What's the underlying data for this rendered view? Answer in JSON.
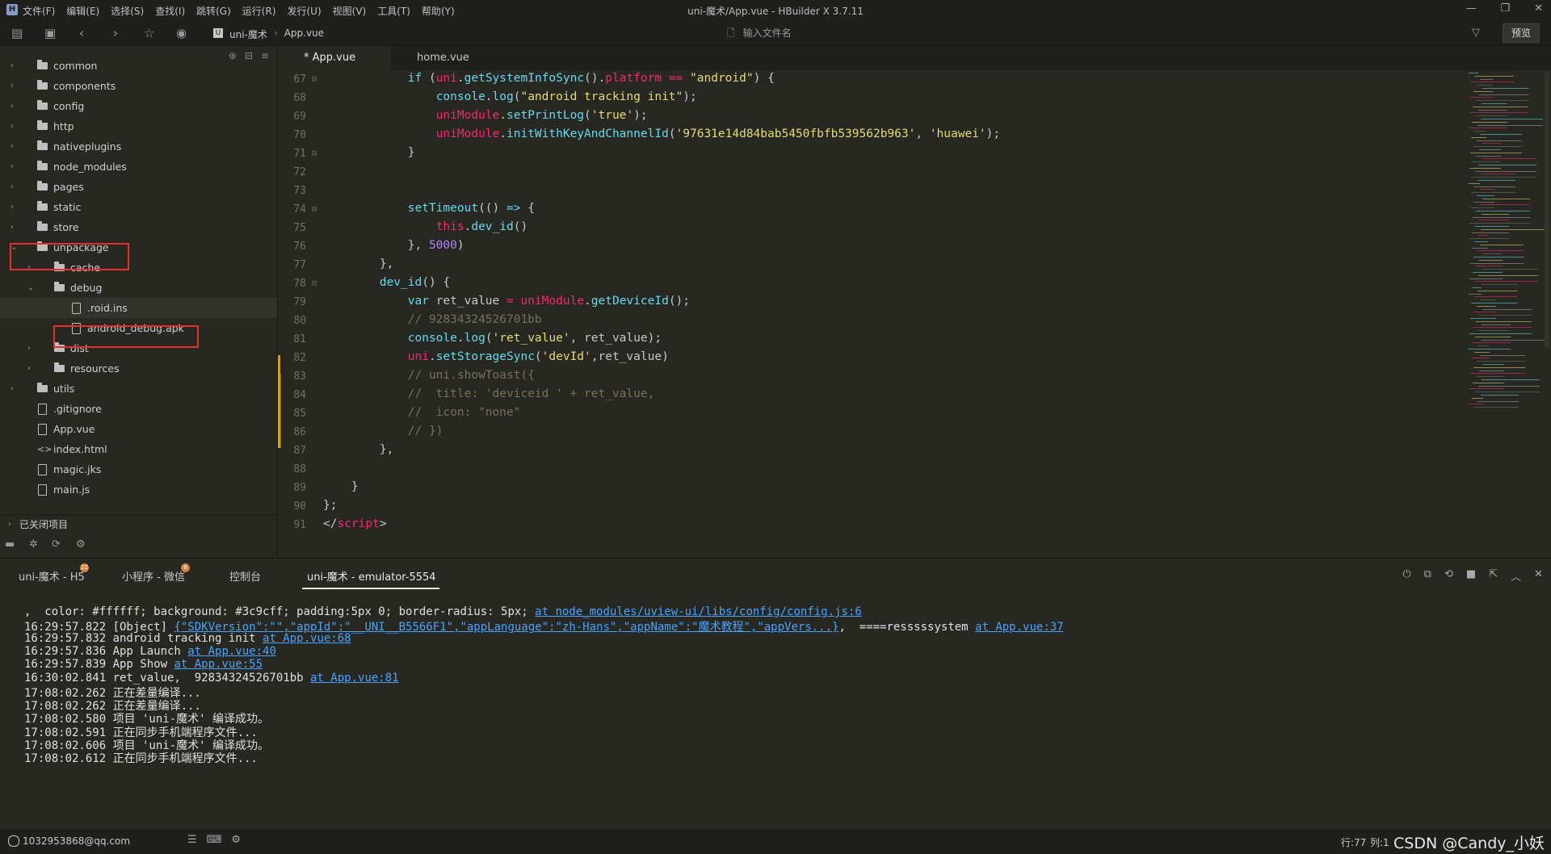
{
  "window": {
    "title": "uni-魔术/App.vue - HBuilder X 3.7.11",
    "menu": [
      "文件(F)",
      "编辑(E)",
      "选择(S)",
      "查找(I)",
      "跳转(G)",
      "运行(R)",
      "发行(U)",
      "视图(V)",
      "工具(T)",
      "帮助(Y)"
    ],
    "controls": [
      "—",
      "❐",
      "✕"
    ]
  },
  "toolbar": {
    "breadcrumb": [
      "uni-魔术",
      "App.vue"
    ],
    "search_placeholder": "输入文件名",
    "preview_label": "预览"
  },
  "sidebar": {
    "items": [
      {
        "label": "common",
        "type": "folder",
        "level": 0,
        "expanded": false
      },
      {
        "label": "components",
        "type": "folder",
        "level": 0,
        "expanded": false
      },
      {
        "label": "config",
        "type": "folder",
        "level": 0,
        "expanded": false
      },
      {
        "label": "http",
        "type": "folder",
        "level": 0,
        "expanded": false
      },
      {
        "label": "nativeplugins",
        "type": "folder",
        "level": 0,
        "expanded": false
      },
      {
        "label": "node_modules",
        "type": "folder",
        "level": 0,
        "expanded": false
      },
      {
        "label": "pages",
        "type": "folder",
        "level": 0,
        "expanded": false
      },
      {
        "label": "static",
        "type": "folder",
        "level": 0,
        "expanded": false
      },
      {
        "label": "store",
        "type": "folder",
        "level": 0,
        "expanded": false
      },
      {
        "label": "unpackage",
        "type": "folder",
        "level": 0,
        "expanded": true,
        "highlighted": true
      },
      {
        "label": "cache",
        "type": "folder",
        "level": 1,
        "expanded": false
      },
      {
        "label": "debug",
        "type": "folder",
        "level": 1,
        "expanded": true
      },
      {
        "label": ".roid.ins",
        "type": "file",
        "level": 2,
        "selected": true
      },
      {
        "label": "android_debug.apk",
        "type": "file",
        "level": 2,
        "highlighted": true
      },
      {
        "label": "dist",
        "type": "folder",
        "level": 1,
        "expanded": false
      },
      {
        "label": "resources",
        "type": "folder",
        "level": 1,
        "expanded": false
      },
      {
        "label": "utils",
        "type": "folder",
        "level": 0,
        "expanded": false
      },
      {
        "label": ".gitignore",
        "type": "file",
        "level": 0
      },
      {
        "label": "App.vue",
        "type": "file",
        "level": 0
      },
      {
        "label": "index.html",
        "type": "code",
        "level": 0
      },
      {
        "label": "magic.jks",
        "type": "file",
        "level": 0
      },
      {
        "label": "main.js",
        "type": "file",
        "level": 0
      }
    ],
    "closed_projects": "已关闭项目"
  },
  "editor": {
    "tabs": [
      {
        "label": "* App.vue",
        "active": true
      },
      {
        "label": "home.vue",
        "active": false
      }
    ],
    "line_numbers": [
      "67",
      "68",
      "69",
      "70",
      "71",
      "72",
      "73",
      "74",
      "75",
      "76",
      "77",
      "78",
      "79",
      "80",
      "81",
      "82",
      "83",
      "84",
      "85",
      "86",
      "87",
      "88",
      "89",
      "90",
      "91"
    ]
  },
  "panel": {
    "tabs": [
      {
        "label": "uni-魔术 - H5",
        "badge": "22"
      },
      {
        "label": "小程序 - 微信",
        "badge": "8"
      },
      {
        "label": "控制台",
        "badge": ""
      },
      {
        "label": "uni-魔术 - emulator-5554",
        "badge": "",
        "active": true
      }
    ],
    "console": [
      {
        "text": ",  color: #ffffff; background: #3c9cff; padding:5px 0; border-radius: 5px; ",
        "link": "at node_modules/uview-ui/libs/config/config.js:6",
        "after": ""
      },
      {
        "text": "16:29:57.822 [Object] ",
        "link": "{\"SDKVersion\":\"\",\"appId\":\"__UNI__B5566F1\",\"appLanguage\":\"zh-Hans\",\"appName\":\"魔术教程\",\"appVers...}",
        "after": ",  ====resssssystem ",
        "link2": "at App.vue:37"
      },
      {
        "text": "16:29:57.832 android tracking init ",
        "link": "at App.vue:68",
        "after": ""
      },
      {
        "text": "16:29:57.836 App Launch ",
        "link": "at App.vue:40",
        "after": ""
      },
      {
        "text": "16:29:57.839 App Show ",
        "link": "at App.vue:55",
        "after": ""
      },
      {
        "text": "16:30:02.841 ret_value,  92834324526701bb ",
        "link": "at App.vue:81",
        "after": ""
      },
      {
        "text": "17:08:02.262 正在差量编译...",
        "link": "",
        "after": ""
      },
      {
        "text": "17:08:02.262 正在差量编译...",
        "link": "",
        "after": ""
      },
      {
        "text": "17:08:02.580 项目 'uni-魔术' 编译成功。",
        "link": "",
        "after": ""
      },
      {
        "text": "17:08:02.591 正在同步手机端程序文件...",
        "link": "",
        "after": ""
      },
      {
        "text": "17:08:02.606 项目 'uni-魔术' 编译成功。",
        "link": "",
        "after": ""
      },
      {
        "text": "17:08:02.612 正在同步手机端程序文件...",
        "link": "",
        "after": ""
      }
    ]
  },
  "statusbar": {
    "user": "1032953868@qq.com",
    "line": "行:77",
    "col": "列:1",
    "watermark": "CSDN @Candy_小妖"
  },
  "colors": {
    "accent_red": "#e8302a",
    "link_blue": "#4aa3ff",
    "badge_orange": "#d9803a"
  }
}
